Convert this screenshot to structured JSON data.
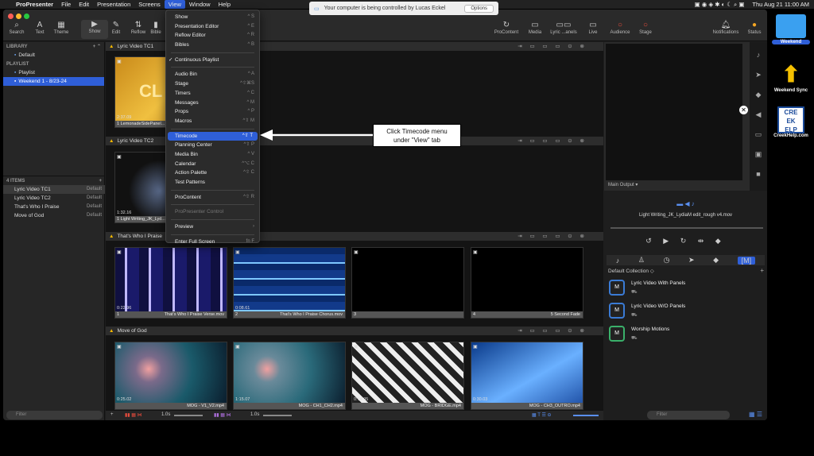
{
  "menubar": {
    "app": "ProPresenter",
    "items": [
      "File",
      "Edit",
      "Presentation",
      "Screens",
      "View",
      "Window",
      "Help"
    ],
    "datetime": "Thu Aug 21  11:00 AM"
  },
  "banner": {
    "text": "Your computer is being controlled by Lucas Eckel",
    "options": "Options"
  },
  "toolbar": {
    "left": [
      "Search",
      "Text",
      "Theme"
    ],
    "mid": [
      "Show",
      "Edit",
      "Reflow",
      "Bible"
    ],
    "right": [
      "ProContent",
      "Media",
      "Lyric ...anels",
      "Live",
      "Audience",
      "Stage",
      "Notifications",
      "Status"
    ]
  },
  "sidebar": {
    "library_header": "LIBRARY",
    "library_item": "Default",
    "playlist_header": "PLAYLIST",
    "playlist_items": [
      "Playlist",
      "Weekend 1 - 8/23-24"
    ],
    "count_header": "4 ITEMS",
    "items": [
      {
        "name": "Lyric Video TC1",
        "lib": "Default"
      },
      {
        "name": "Lyric Video TC2",
        "lib": "Default"
      },
      {
        "name": "That's Who I Praise",
        "lib": "Default"
      },
      {
        "name": "Move of God",
        "lib": "Default"
      }
    ],
    "filter_placeholder": "Filter"
  },
  "main": {
    "groups": [
      {
        "title": "Lyric Video TC1"
      },
      {
        "title": "Lyric Video TC2"
      },
      {
        "title": "That's Who I Praise"
      },
      {
        "title": "Move of God"
      }
    ],
    "slides_tc1": [
      {
        "time": "2:37.09",
        "num": "1",
        "name": "LemonadeSidePanel..."
      }
    ],
    "slides_tc2": [
      {
        "time": "1:32.16",
        "num": "1",
        "name": "Light Writing_JK_Lyd..."
      }
    ],
    "slides_twip": [
      {
        "time": "0:22.96",
        "num": "1",
        "name": "That's Who I Praise Verse.mov"
      },
      {
        "time": "0:08.61",
        "num": "2",
        "name": "That's Who I Praise Chorus.mov"
      },
      {
        "time": "",
        "num": "3",
        "name": ""
      },
      {
        "time": "",
        "num": "4",
        "name": "5 Second Fade"
      }
    ],
    "slides_mog": [
      {
        "time": "0:25.02",
        "num": "",
        "name": "MOG - V1_V2.mp4"
      },
      {
        "time": "1:15.07",
        "num": "",
        "name": "MOG - CH1_CH2.mp4"
      },
      {
        "time": "0:14.95",
        "num": "",
        "name": "MOG - BRIDGE.mp4"
      },
      {
        "time": "0:30.03",
        "num": "",
        "name": "MOG - CH3_OUTRO.mp4"
      }
    ]
  },
  "bottombar": {
    "speed1": "1.0s",
    "speed2": "1.0s"
  },
  "view_menu": {
    "items": [
      {
        "label": "Show",
        "sc": "^ S"
      },
      {
        "label": "Presentation Editor",
        "sc": "^ E"
      },
      {
        "label": "Reflow Editor",
        "sc": "^ R"
      },
      {
        "label": "Bibles",
        "sc": "^ B"
      },
      {
        "label": "Continuous Playlist",
        "sc": ""
      },
      {
        "label": "Audio Bin",
        "sc": "^ A"
      },
      {
        "label": "Stage",
        "sc": "^⇧⌘S"
      },
      {
        "label": "Timers",
        "sc": "^ C"
      },
      {
        "label": "Messages",
        "sc": "^ M"
      },
      {
        "label": "Props",
        "sc": "^ P"
      },
      {
        "label": "Macros",
        "sc": "^⇧ M"
      },
      {
        "label": "Timecode",
        "sc": "^⇧ T"
      },
      {
        "label": "Planning Center",
        "sc": "^⇧ P"
      },
      {
        "label": "Media Bin",
        "sc": "^ V"
      },
      {
        "label": "Calendar",
        "sc": "^⌥ C"
      },
      {
        "label": "Action Palette",
        "sc": "^⇧ C"
      },
      {
        "label": "Test Patterns",
        "sc": ""
      },
      {
        "label": "ProContent",
        "sc": "^⇧ R"
      },
      {
        "label": "ProPresenter Control",
        "sc": ""
      },
      {
        "label": "Preview",
        "sc": "›"
      },
      {
        "label": "Enter Full Screen",
        "sc": "fn F"
      }
    ]
  },
  "annotation": {
    "line1": "Click Timecode menu",
    "line2": "under \"View\" tab"
  },
  "right": {
    "output_label": "Main Output ▾",
    "now_playing": "Light Writing_JK_LydiaM edit_rough v4.mov",
    "collection": "Default Collection ◇",
    "media": [
      {
        "name": "Lyric Video With Panels"
      },
      {
        "name": "Lyric Video W/O Panels"
      },
      {
        "name": "Worship Motions"
      }
    ],
    "filter_placeholder": "Filter"
  },
  "desktop": {
    "icons": [
      "Weekend",
      "Weekend Sync",
      "CreekHelp.com"
    ]
  }
}
